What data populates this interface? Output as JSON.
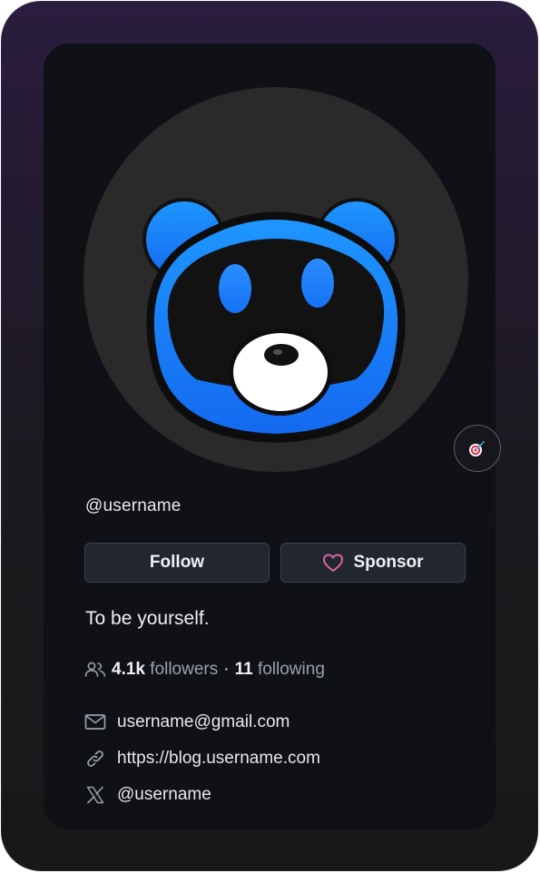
{
  "profile": {
    "username": "@username",
    "bio": "To be yourself.",
    "avatar_icon": "bear-icon",
    "status_icon": "target-dart-icon"
  },
  "actions": {
    "follow_label": "Follow",
    "sponsor_label": "Sponsor",
    "sponsor_icon": "heart-icon"
  },
  "stats": {
    "followers_count": "4.1k",
    "followers_label": "followers",
    "separator": "·",
    "following_count": "11",
    "following_label": "following",
    "icon": "people-icon"
  },
  "contacts": {
    "email": "username@gmail.com",
    "website": "https://blog.username.com",
    "x_handle": "@username"
  },
  "colors": {
    "card_bg": "#0f1116",
    "avatar_bg": "#2a2a2a",
    "bear_blue": "#1a8cff",
    "heart": "#db61a2"
  }
}
